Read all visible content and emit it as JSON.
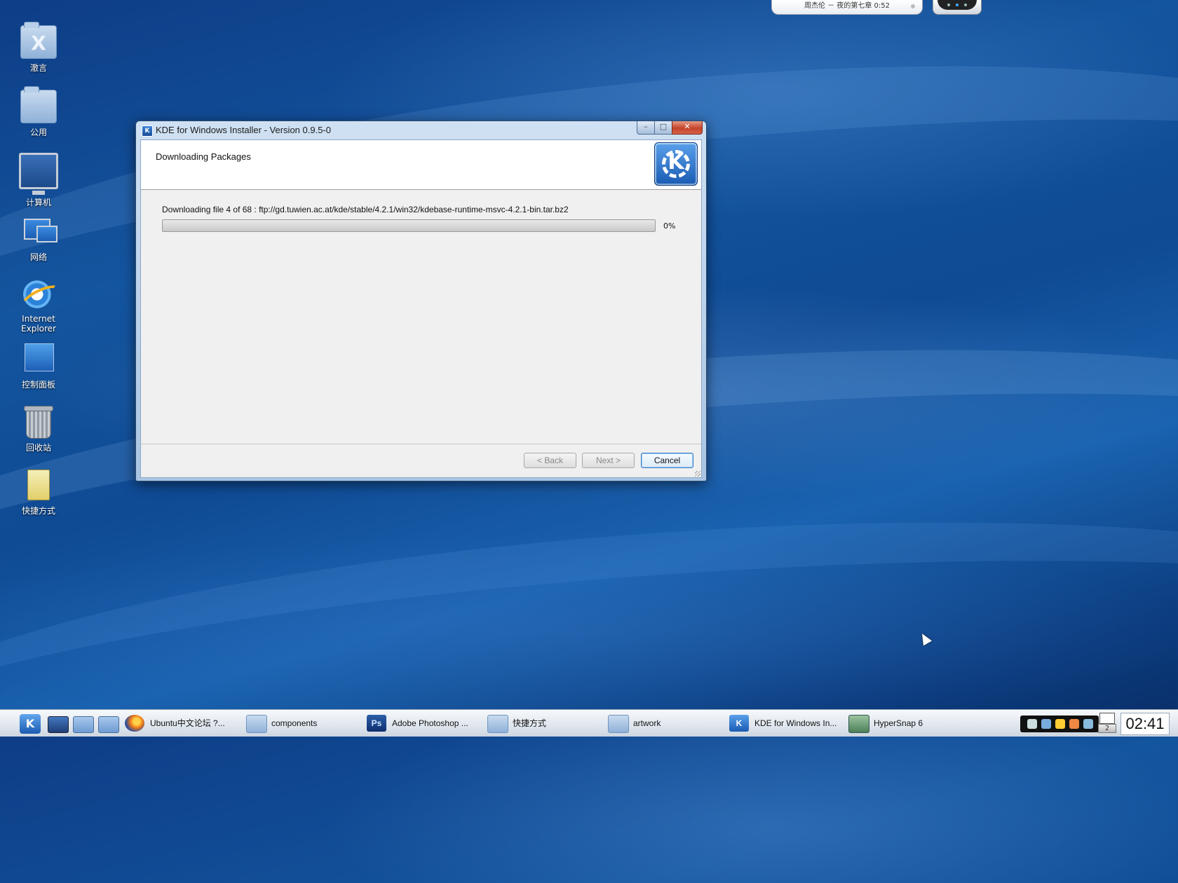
{
  "desktop": {
    "icons": [
      {
        "label": "澈言",
        "icon": "user-folder-icon"
      },
      {
        "label": "公用",
        "icon": "public-folder-icon"
      },
      {
        "label": "计算机",
        "icon": "computer-icon"
      },
      {
        "label": "网络",
        "icon": "network-icon"
      },
      {
        "label": "Internet Explorer",
        "icon": "internet-explorer-icon"
      },
      {
        "label": "控制面板",
        "icon": "control-panel-icon"
      },
      {
        "label": "回收站",
        "icon": "recycle-bin-icon"
      },
      {
        "label": "快捷方式",
        "icon": "shortcuts-folder-icon"
      }
    ]
  },
  "music_widget": {
    "text": "周杰伦 － 夜的第七章   0:52"
  },
  "installer": {
    "title": "KDE for Windows Installer - Version 0.9.5-0",
    "header_title": "Downloading Packages",
    "status": "Downloading file 4 of 68 : ftp://gd.tuwien.ac.at/kde/stable/4.2.1/win32/kdebase-runtime-msvc-4.2.1-bin.tar.bz2",
    "progress_percent": 0,
    "progress_label": "0%",
    "buttons": {
      "back": "< Back",
      "next": "Next >",
      "cancel": "Cancel"
    },
    "window_controls": {
      "minimize": "–",
      "maximize": "□",
      "close": "✕"
    },
    "logo_letter": "K"
  },
  "taskbar": {
    "start_label": "K",
    "tasks": [
      {
        "label": "Ubuntu中文论坛 ?...",
        "icon": "firefox-icon"
      },
      {
        "label": "components",
        "icon": "folder-icon"
      },
      {
        "label": "Adobe Photoshop ...",
        "icon": "photoshop-icon",
        "icon_text": "Ps"
      },
      {
        "label": "快捷方式",
        "icon": "folder-icon"
      },
      {
        "label": "artwork",
        "icon": "folder-icon"
      },
      {
        "label": "KDE for Windows In...",
        "icon": "kde-icon",
        "icon_text": "K"
      },
      {
        "label": "HyperSnap 6",
        "icon": "hypersnap-icon"
      }
    ],
    "pager_number": "2",
    "clock": "02:41"
  },
  "colors": {
    "desktop_blue": "#14559f",
    "window_frame": "#a9c5e3",
    "close_red": "#c4442a",
    "accent_blue": "#3b7bc4"
  }
}
